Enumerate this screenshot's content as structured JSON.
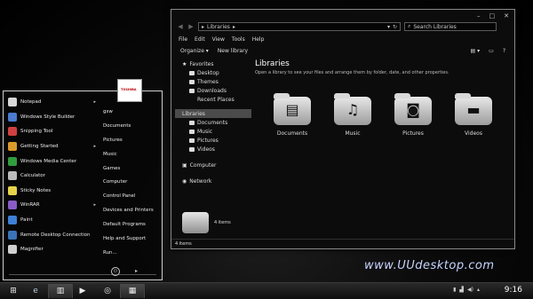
{
  "explorer": {
    "address": {
      "breadcrumb": "Libraries",
      "arrow": "▸"
    },
    "search_placeholder": "Search Libraries",
    "menu": [
      "File",
      "Edit",
      "View",
      "Tools",
      "Help"
    ],
    "toolbar": {
      "organize": "Organize ▾",
      "new_library": "New library"
    },
    "nav": {
      "favorites": "Favorites",
      "favorites_items": [
        "Desktop",
        "Themes",
        "Downloads",
        "Recent Places"
      ],
      "libraries": "Libraries",
      "libraries_items": [
        "Documents",
        "Music",
        "Pictures",
        "Videos"
      ],
      "computer": "Computer",
      "network": "Network"
    },
    "content": {
      "title": "Libraries",
      "subtitle": "Open a library to see your files and arrange them by folder, date, and other properties.",
      "libs": [
        "Documents",
        "Music",
        "Pictures",
        "Videos"
      ]
    },
    "preview_count": "4 items",
    "status": "4 items"
  },
  "startmenu": {
    "programs": [
      {
        "label": "Notepad",
        "arrow": "▸",
        "color": "#d8d8d8"
      },
      {
        "label": "Windows Style Builder",
        "arrow": "",
        "color": "#4a7bd0"
      },
      {
        "label": "Snipping Tool",
        "arrow": "",
        "color": "#d04040"
      },
      {
        "label": "Getting Started",
        "arrow": "▸",
        "color": "#d99a2b"
      },
      {
        "label": "Windows Media Center",
        "arrow": "",
        "color": "#2e9e3e"
      },
      {
        "label": "Calculator",
        "arrow": "",
        "color": "#bbbbbb"
      },
      {
        "label": "Sticky Notes",
        "arrow": "",
        "color": "#e6d44a"
      },
      {
        "label": "WinRAR",
        "arrow": "▸",
        "color": "#8a5cc7"
      },
      {
        "label": "Paint",
        "arrow": "",
        "color": "#3d7fd6"
      },
      {
        "label": "Remote Desktop Connection",
        "arrow": "",
        "color": "#3a73b8"
      },
      {
        "label": "Magnifier",
        "arrow": "",
        "color": "#cfcfcf"
      }
    ],
    "right": [
      "gsw",
      "Documents",
      "Pictures",
      "Music",
      "Games",
      "Computer",
      "Control Panel",
      "Devices and Printers",
      "Default Programs",
      "Help and Support",
      "Run..."
    ],
    "user_logo": "TOSHIBA",
    "power_arrow": "▸"
  },
  "watermark": "www.UUdesktop.com",
  "taskbar": {
    "clock": "9:16"
  }
}
